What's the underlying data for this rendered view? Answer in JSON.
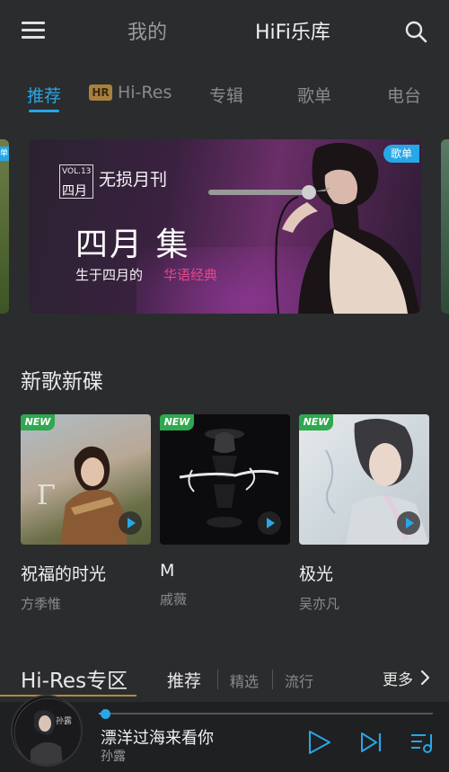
{
  "header": {
    "mine_label": "我的",
    "library_label": "HiFi乐库"
  },
  "categories": {
    "tabs": [
      {
        "label": "推荐",
        "active": true
      },
      {
        "label": "Hi-Res",
        "badge": "HR"
      },
      {
        "label": "专辑"
      },
      {
        "label": "歌单"
      },
      {
        "label": "电台"
      }
    ]
  },
  "banner": {
    "vol_line1": "VOL.13",
    "vol_line2": "四月",
    "subtitle": "无损月刊",
    "title": "四月  集",
    "tagline_a": "生于四月的",
    "tagline_b": "华语经典",
    "badge": "歌单",
    "side_badge": "单"
  },
  "new_releases": {
    "title": "新歌新碟",
    "new_tag": "NEW",
    "albums": [
      {
        "title": "祝福的时光",
        "artist": "方季惟"
      },
      {
        "title": "M",
        "artist": "戚薇"
      },
      {
        "title": "极光",
        "artist": "吴亦凡"
      }
    ]
  },
  "hires_zone": {
    "title": "Hi-Res专区",
    "tabs": [
      "推荐",
      "精选",
      "流行"
    ],
    "more": "更多"
  },
  "player": {
    "song": "漂洋过海来看你",
    "artist": "孙露",
    "progress": 0.02
  },
  "colors": {
    "accent": "#27a7e7",
    "background": "#2b2c2e",
    "new_tag": "#2fa84f",
    "hires_gold": "#b08a3e"
  },
  "icons": [
    "menu-icon",
    "search-icon",
    "play-icon",
    "next-icon",
    "playlist-icon",
    "chevron-right-icon",
    "play-circle-icon"
  ]
}
